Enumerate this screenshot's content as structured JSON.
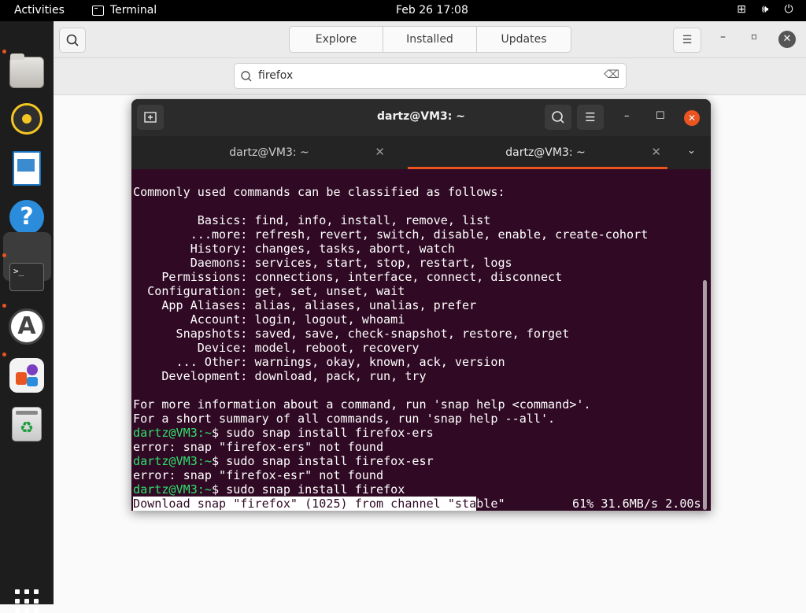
{
  "topbar": {
    "activities": "Activities",
    "app_name": "Terminal",
    "clock": "Feb 26  17:08",
    "icons": [
      "network-icon",
      "volume-icon",
      "power-icon"
    ]
  },
  "dock": {
    "items": [
      "files",
      "rhythmbox",
      "libreoffice-writer",
      "help",
      "terminal",
      "software-updater",
      "app-center",
      "trash",
      "show-applications"
    ]
  },
  "software": {
    "tabs": [
      "Explore",
      "Installed",
      "Updates"
    ],
    "search_value": "firefox"
  },
  "terminal": {
    "title": "dartz@VM3: ~",
    "tabs": [
      {
        "label": "dartz@VM3: ~"
      },
      {
        "label": "dartz@VM3: ~"
      }
    ],
    "lines": [
      "Commonly used commands can be classified as follows:",
      "",
      "         Basics: find, info, install, remove, list",
      "        ...more: refresh, revert, switch, disable, enable, create-cohort",
      "        History: changes, tasks, abort, watch",
      "        Daemons: services, start, stop, restart, logs",
      "    Permissions: connections, interface, connect, disconnect",
      "  Configuration: get, set, unset, wait",
      "    App Aliases: alias, aliases, unalias, prefer",
      "        Account: login, logout, whoami",
      "      Snapshots: saved, save, check-snapshot, restore, forget",
      "         Device: model, reboot, recovery",
      "      ... Other: warnings, okay, known, ack, version",
      "    Development: download, pack, run, try",
      "",
      "For more information about a command, run 'snap help <command>'.",
      "For a short summary of all commands, run 'snap help --all'."
    ],
    "history": [
      {
        "prompt": "dartz@VM3",
        "path": ":~",
        "cmd": "$ sudo snap install firefox-ers"
      },
      {
        "output": "error: snap \"firefox-ers\" not found"
      },
      {
        "prompt": "dartz@VM3",
        "path": ":~",
        "cmd": "$ sudo snap install firefox-esr"
      },
      {
        "output": "error: snap \"firefox-esr\" not found"
      },
      {
        "prompt": "dartz@VM3",
        "path": ":~",
        "cmd": "$ sudo snap install firefox"
      }
    ],
    "download": {
      "highlighted": "Download snap \"firefox\" (1025) from channel \"sta",
      "rest": "ble\"",
      "progress": "61%",
      "speed": "31.6MB/s",
      "eta": "2.00s"
    }
  }
}
